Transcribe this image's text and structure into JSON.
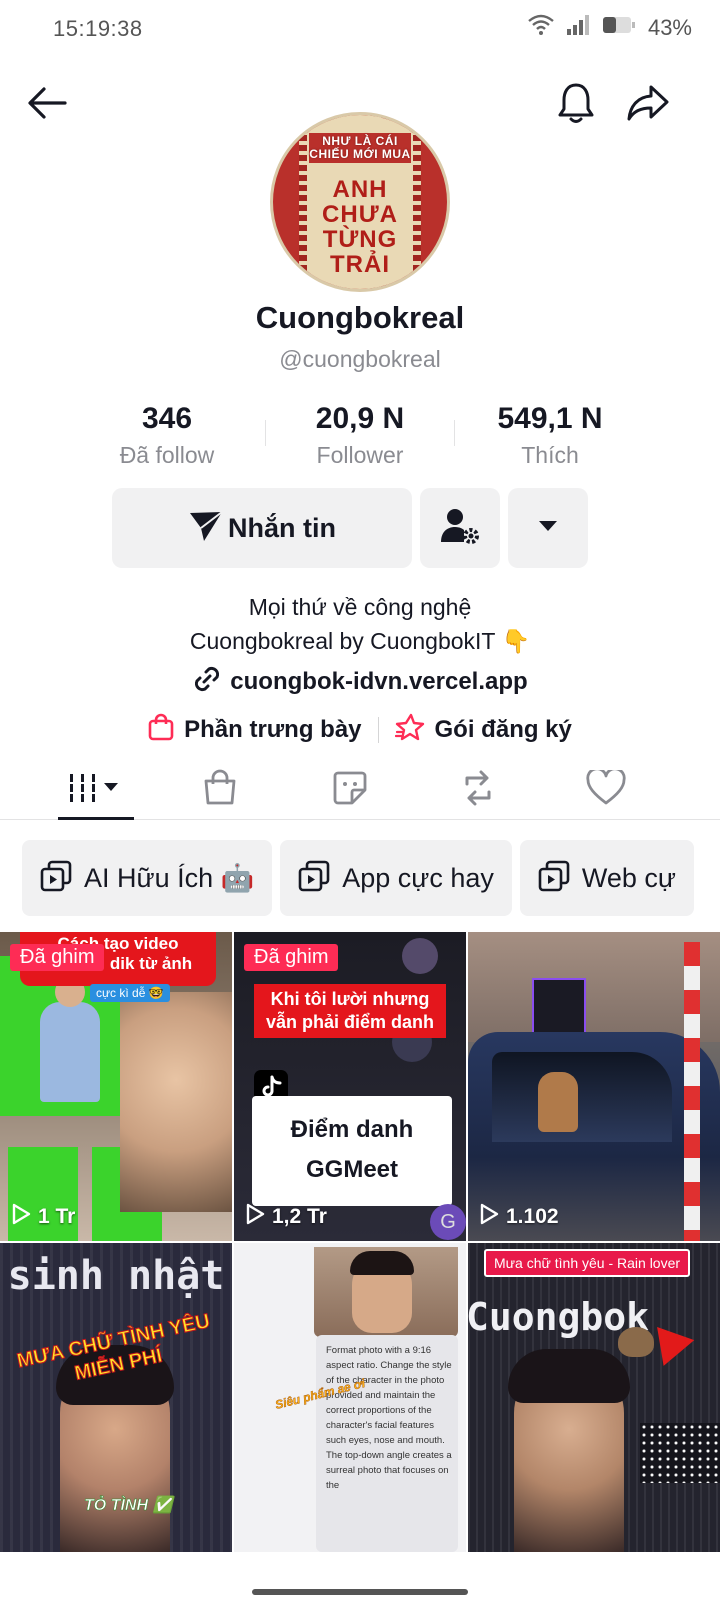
{
  "status": {
    "time": "15:19:38",
    "battery": "43%"
  },
  "header": {
    "back_icon": "arrow-left-icon",
    "bell_icon": "bell-icon",
    "share_icon": "share-icon"
  },
  "avatar": {
    "small_text": "NHƯ LÀ CÁI CHIẾU MỚI MUA",
    "main_text": "ANH CHƯA TỪNG TRẢI"
  },
  "profile": {
    "display_name": "Cuongbokreal",
    "username": "@cuongbokreal"
  },
  "stats": [
    {
      "value": "346",
      "label": "Đã follow"
    },
    {
      "value": "20,9 N",
      "label": "Follower"
    },
    {
      "value": "549,1 N",
      "label": "Thích"
    }
  ],
  "actions": {
    "message_label": "Nhắn tin"
  },
  "bio": {
    "line1": "Mọi thứ về công nghệ",
    "line2": "Cuongbokreal by CuongbokIT 👇",
    "link": "cuongbok-idvn.vercel.app"
  },
  "shop": {
    "showcase_label": "Phần trưng bày",
    "subscription_label": "Gói đăng ký"
  },
  "chips": [
    {
      "label": "AI Hữu Ích 🤖"
    },
    {
      "label": "App cực hay"
    },
    {
      "label": "Web cự"
    }
  ],
  "videos": [
    {
      "pinned_label": "Đã ghim",
      "views": "1 Tr",
      "caption_top": "Cách tạo video",
      "caption_bottom": "dik từ ảnh",
      "tag": "cực kì dễ 🤓"
    },
    {
      "pinned_label": "Đã ghim",
      "views": "1,2 Tr",
      "caption": "Khi tôi lười nhưng vẫn phải điểm danh",
      "title1": "Điểm danh",
      "title2": "GGMeet"
    },
    {
      "views": "1.102"
    },
    {
      "caption_top": "sinh nhật",
      "caption": "MƯA CHỮ TÌNH YÊU MIỄN PHÍ",
      "tag": "TỎ TÌNH ✅"
    },
    {
      "text": "Format photo with a 9:16 aspect ratio. Change the style of the character in the photo provided and maintain the correct proportions of the character's facial features such eyes, nose and mouth. The top-down angle creates a surreal photo that focuses on the",
      "tag": "Siêu phẩm ae ơi"
    },
    {
      "caption": "Mưa chữ tình yêu - Rain lover",
      "caption_big": "Cuongbok"
    }
  ],
  "colors": {
    "accent": "#fe2c55",
    "text": "#161823",
    "muted": "#8a8b91",
    "button_bg": "#f1f1f2"
  }
}
